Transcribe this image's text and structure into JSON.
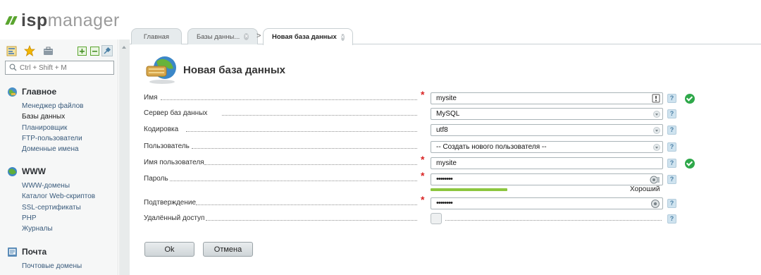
{
  "brand": {
    "isp": "isp",
    "manager": "manager",
    "accent": "#5aa52f"
  },
  "search": {
    "placeholder": "Ctrl + Shift + M"
  },
  "sidebar": {
    "sections": [
      {
        "title": "Главное",
        "icon": "globe-icon",
        "items": [
          "Менеджер файлов",
          "Базы данных",
          "Планировщик",
          "FTP-пользователи",
          "Доменные имена"
        ]
      },
      {
        "title": "WWW",
        "icon": "www-globe-icon",
        "items": [
          "WWW-домены",
          "Каталог Web-скриптов",
          "SSL-сертификаты",
          "PHP",
          "Журналы"
        ]
      },
      {
        "title": "Почта",
        "icon": "mail-icon",
        "items": [
          "Почтовые домены"
        ]
      }
    ],
    "active_item": "Базы данных"
  },
  "tabs": [
    {
      "label": "Главная"
    },
    {
      "label": "Базы данны..."
    },
    {
      "label": "Новая база данных"
    }
  ],
  "page": {
    "title": "Новая база данных"
  },
  "form": {
    "name": {
      "label": "Имя",
      "value": "mysite",
      "required": true,
      "valid": true
    },
    "server": {
      "label": "Сервер баз данных",
      "value": "MySQL"
    },
    "encoding": {
      "label": "Кодировка",
      "value": "utf8"
    },
    "user": {
      "label": "Пользователь",
      "value": "-- Создать нового пользователя --"
    },
    "username": {
      "label": "Имя пользователя",
      "value": "mysite",
      "required": true,
      "valid": true
    },
    "password": {
      "label": "Пароль",
      "value": "••••••••",
      "required": true,
      "strength_label": "Хороший",
      "strength": 0.33
    },
    "confirm": {
      "label": "Подтверждение",
      "value": "••••••••",
      "required": true
    },
    "remote": {
      "label": "Удалённый доступ",
      "checked": false
    },
    "required_mark": "*",
    "help_mark": "?"
  },
  "buttons": {
    "ok": "Ok",
    "cancel": "Отмена"
  }
}
